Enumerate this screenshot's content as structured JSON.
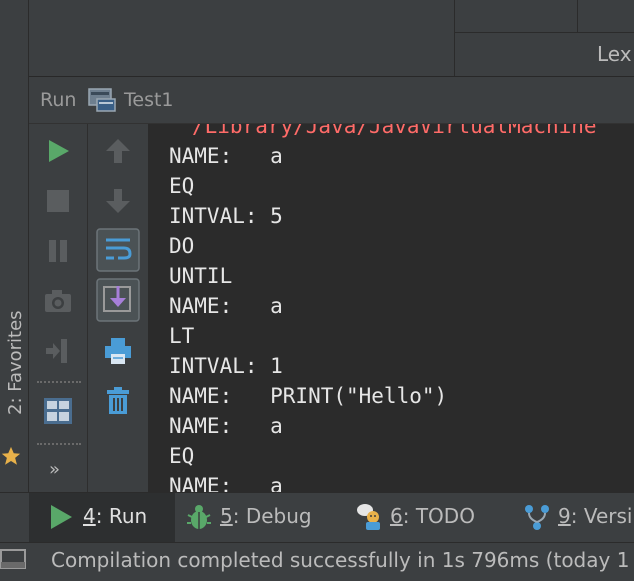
{
  "favorites": {
    "label": "2: Favorites",
    "icon": "star-icon"
  },
  "editor_tab": {
    "label": "Lex"
  },
  "run_panel": {
    "title": "Run",
    "config_name": "Test1",
    "left_toolbar": [
      "rerun-icon",
      "stop-icon",
      "pause-icon",
      "camera-icon",
      "restore-layout-icon",
      "layout-icon",
      "more-icon"
    ],
    "right_toolbar": [
      "up-arrow-icon",
      "down-arrow-icon",
      "soft-wrap-icon",
      "scroll-to-end-icon",
      "print-icon",
      "trash-icon"
    ],
    "more_label": "»"
  },
  "console": {
    "path_line": "/Library/Java/JavaVirtualMachine",
    "lines": [
      "NAME:   a",
      "EQ",
      "INTVAL: 5",
      "DO",
      "UNTIL",
      "NAME:   a",
      "LT",
      "INTVAL: 1",
      "NAME:   PRINT(\"Hello\")",
      "NAME:   a",
      "EQ",
      "NAME:   a"
    ]
  },
  "tool_tabs": [
    {
      "num": "4",
      "label": ": Run",
      "icon": "run-icon",
      "active": true
    },
    {
      "num": "5",
      "label": ": Debug",
      "icon": "bug-icon",
      "active": false
    },
    {
      "num": "6",
      "label": ": TODO",
      "icon": "todo-icon",
      "active": false
    },
    {
      "num": "9",
      "label": ": Versi",
      "icon": "vcs-icon",
      "active": false
    }
  ],
  "status": {
    "text": "Compilation completed successfully in 1s 796ms (today 1"
  },
  "colors": {
    "run_green": "#59a869",
    "error_red": "#ff6b68",
    "panel": "#3c3f41",
    "console_bg": "#2b2b2b"
  }
}
